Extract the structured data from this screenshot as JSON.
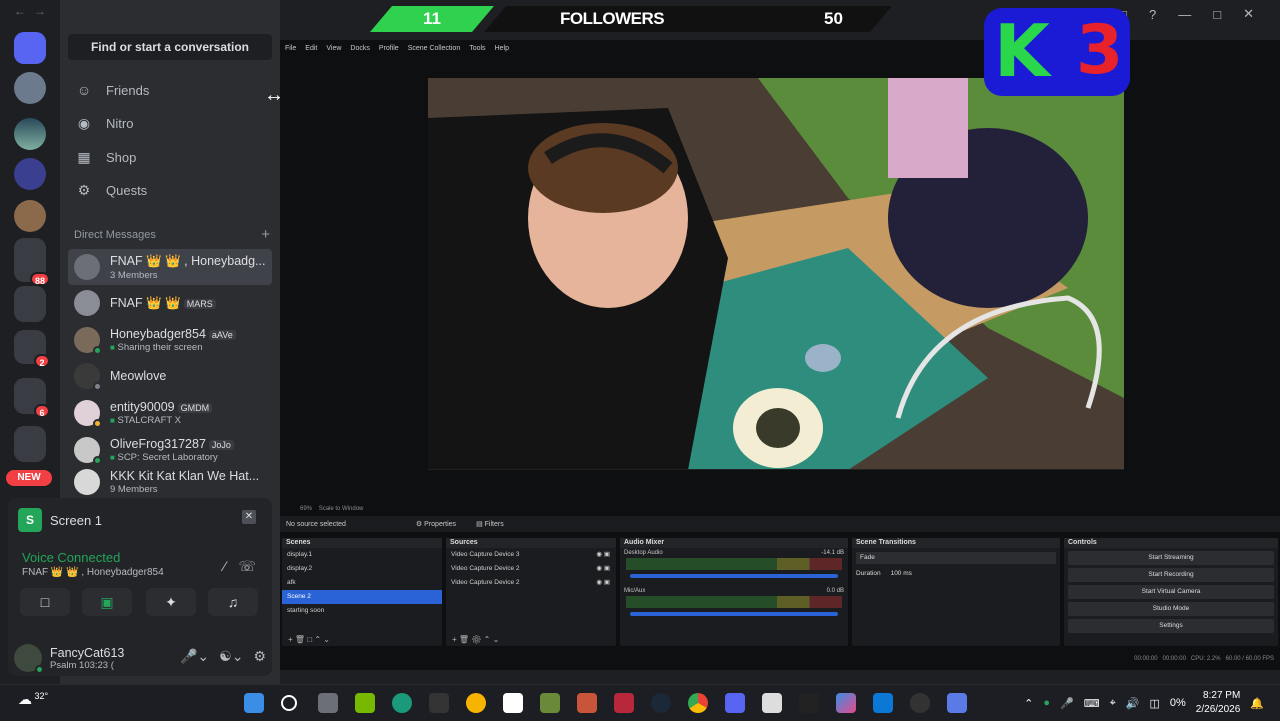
{
  "window": {
    "dm_overlay_title": "Direct Messages"
  },
  "rail": {
    "badges": [
      "88",
      "2",
      "6"
    ],
    "new_label": "NEW"
  },
  "sidebar": {
    "search_placeholder": "Find or start a conversation",
    "nav": [
      {
        "label": "Friends",
        "icon": "friends-icon"
      },
      {
        "label": "Nitro",
        "icon": "nitro-icon"
      },
      {
        "label": "Shop",
        "icon": "shop-icon"
      },
      {
        "label": "Quests",
        "icon": "quests-icon"
      }
    ],
    "dm_header": "Direct Messages",
    "dms": [
      {
        "name": "FNAF 👑 👑 , Honeybadg...",
        "sub": "3 Members",
        "tag": ""
      },
      {
        "name": "FNAF 👑 👑",
        "sub": "",
        "tag": "MARS"
      },
      {
        "name": "Honeybadger854",
        "sub": "Sharing their screen",
        "tag": "aAVe"
      },
      {
        "name": "Meowlove",
        "sub": "",
        "tag": ""
      },
      {
        "name": "entity90009",
        "sub": "STALCRAFT X",
        "tag": "GMDM"
      },
      {
        "name": "OliveFrog317287",
        "sub": "SCP: Secret Laboratory",
        "tag": "JoJo"
      },
      {
        "name": "KKK Kit Kat Klan We Hat...",
        "sub": "9 Members",
        "tag": ""
      }
    ]
  },
  "voice": {
    "screen_title": "Screen 1",
    "screen_icon_letter": "S",
    "status": "Voice Connected",
    "channel": "FNAF 👑 👑 , Honeybadger854"
  },
  "user": {
    "name": "FancyCat613",
    "status": "Psalm 103:23 ("
  },
  "overlay": {
    "current": "11",
    "label": "FOLLOWERS",
    "goal": "50",
    "logo_left": "K",
    "logo_right": "3"
  },
  "obs": {
    "menu": [
      "File",
      "Edit",
      "View",
      "Docks",
      "Profile",
      "Scene Collection",
      "Tools",
      "Help"
    ],
    "zoom": "69%",
    "scale_label": "Scale to Window",
    "no_source": "No source selected",
    "properties": "Properties",
    "filters": "Filters",
    "scenes_title": "Scenes",
    "scenes": [
      "display.1",
      "display.2",
      "afk",
      "Scene 2",
      "starting soon"
    ],
    "selected_scene_index": 3,
    "sources_title": "Sources",
    "sources": [
      "Video Capture Device 3",
      "Video Capture Device 2",
      "Video Capture Device 2"
    ],
    "mixer_title": "Audio Mixer",
    "mixer": [
      {
        "name": "Desktop Audio",
        "db": "-14.1 dB"
      },
      {
        "name": "Mic/Aux",
        "db": "0.0 dB"
      }
    ],
    "transitions_title": "Scene Transitions",
    "transition": "Fade",
    "duration_label": "Duration",
    "duration_value": "100 ms",
    "controls_title": "Controls",
    "controls": [
      "Start Streaming",
      "Start Recording",
      "Start Virtual Camera",
      "Studio Mode",
      "Settings"
    ],
    "status_stream": "00:00:00",
    "status_rec": "00:00:00",
    "cpu": "CPU: 2.2%",
    "fps": "60.00 / 60.00 FPS"
  },
  "taskbar": {
    "temperature": "32°",
    "battery": "0%",
    "time": "8:27 PM",
    "date": "2/26/2026"
  }
}
